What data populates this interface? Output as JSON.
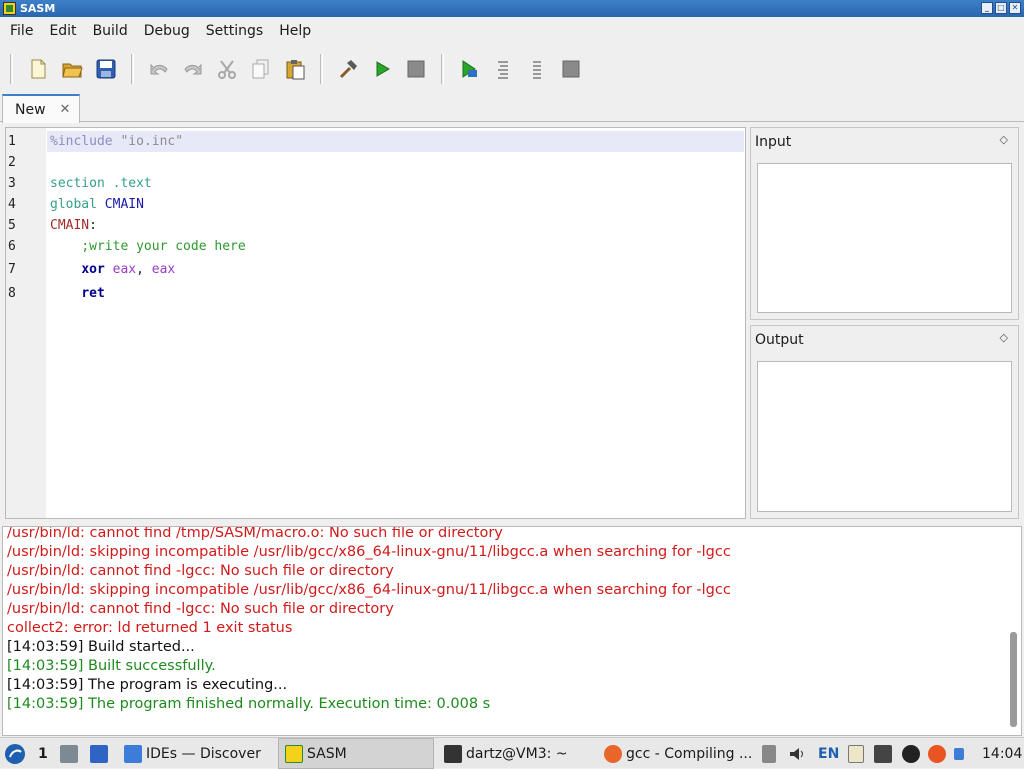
{
  "window": {
    "title": "SASM"
  },
  "menu": {
    "items": [
      "File",
      "Edit",
      "Build",
      "Debug",
      "Settings",
      "Help"
    ]
  },
  "toolbar": {
    "buttons": [
      "new-file",
      "open-file",
      "save",
      "undo",
      "redo",
      "cut",
      "copy",
      "paste",
      "build",
      "run",
      "stop",
      "debug",
      "step-over",
      "step-into",
      "stop-debug"
    ]
  },
  "tabs": [
    {
      "label": "New",
      "close": "✕"
    }
  ],
  "editor": {
    "line_numbers": [
      "1",
      "2",
      "3",
      "4",
      "5",
      "6",
      "7",
      "8"
    ],
    "lines": {
      "l1_directive": "%include",
      "l1_string": "\"io.inc\"",
      "l3_section": "section .text",
      "l4_global": "global",
      "l4_symbol": "CMAIN",
      "l5_label": "CMAIN",
      "l5_colon": ":",
      "l6_comment": ";write your code here",
      "l7_instr": "xor",
      "l7_reg1": "eax",
      "l7_comma": ",",
      "l7_reg2": "eax",
      "l8_instr": "ret"
    }
  },
  "panels": {
    "input": {
      "title": "Input",
      "float_icon": "◇"
    },
    "output": {
      "title": "Output",
      "float_icon": "◇"
    }
  },
  "log": {
    "lines": [
      {
        "text": "/usr/bin/ld: cannot find /tmp/SASM/macro.o: No such file or directory",
        "kind": "error"
      },
      {
        "text": "/usr/bin/ld: skipping incompatible /usr/lib/gcc/x86_64-linux-gnu/11/libgcc.a when searching for -lgcc",
        "kind": "error"
      },
      {
        "text": "/usr/bin/ld: cannot find -lgcc: No such file or directory",
        "kind": "error"
      },
      {
        "text": "/usr/bin/ld: skipping incompatible /usr/lib/gcc/x86_64-linux-gnu/11/libgcc.a when searching for -lgcc",
        "kind": "error"
      },
      {
        "text": "/usr/bin/ld: cannot find -lgcc: No such file or directory",
        "kind": "error"
      },
      {
        "text": "collect2: error: ld returned 1 exit status",
        "kind": "error"
      },
      {
        "text": "[14:03:59] Build started...",
        "kind": "info"
      },
      {
        "text": "[14:03:59] Built successfully.",
        "kind": "success"
      },
      {
        "text": "[14:03:59] The program is executing...",
        "kind": "info"
      },
      {
        "text": "[14:03:59] The program finished normally. Execution time: 0.008 s",
        "kind": "success"
      }
    ]
  },
  "taskbar": {
    "desktop_number": "1",
    "tasks": [
      {
        "label": "IDEs — Discover"
      },
      {
        "label": "SASM"
      },
      {
        "label": "dartz@VM3: ~"
      },
      {
        "label": "gcc - Compiling ..."
      }
    ],
    "keyboard_layout": "EN",
    "clock": "14:04"
  },
  "colors": {
    "titlebar": "#2f6fbf",
    "error": "#d11a1a",
    "success": "#1e8a1e",
    "current_line": "#e7e9f8"
  }
}
